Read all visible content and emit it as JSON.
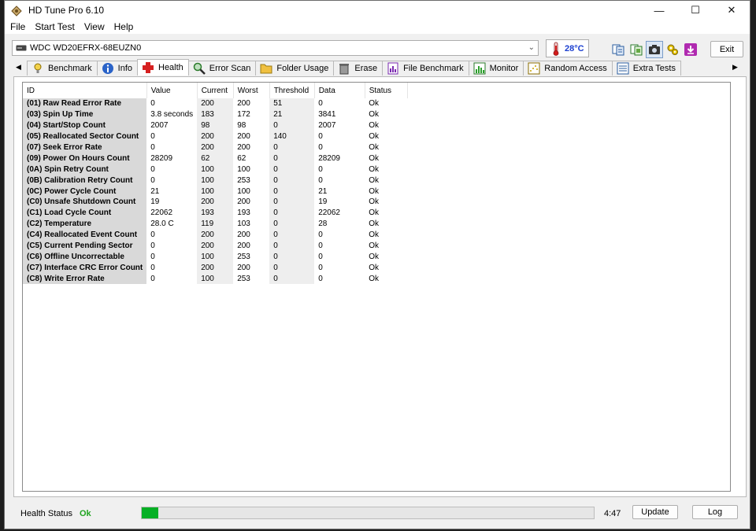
{
  "window": {
    "title": "HD Tune Pro 6.10",
    "controls": [
      "—",
      "☐",
      "✕"
    ]
  },
  "menu": [
    "File",
    "Start Test",
    "View",
    "Help"
  ],
  "toolbar": {
    "drive": "WDC WD20EFRX-68EUZN0",
    "temperature": "28°C",
    "exit_label": "Exit"
  },
  "tabs": [
    {
      "label": "Benchmark",
      "icon": "benchmark-icon"
    },
    {
      "label": "Info",
      "icon": "info-icon"
    },
    {
      "label": "Health",
      "icon": "health-cross-icon",
      "selected": true
    },
    {
      "label": "Error Scan",
      "icon": "magnifier-icon"
    },
    {
      "label": "Folder Usage",
      "icon": "folder-icon"
    },
    {
      "label": "Erase",
      "icon": "trash-icon"
    },
    {
      "label": "File Benchmark",
      "icon": "file-benchmark-icon"
    },
    {
      "label": "Monitor",
      "icon": "monitor-chart-icon"
    },
    {
      "label": "Random Access",
      "icon": "random-access-icon"
    },
    {
      "label": "Extra Tests",
      "icon": "extra-tests-icon"
    }
  ],
  "table": {
    "columns": [
      "ID",
      "Value",
      "Current",
      "Worst",
      "Threshold",
      "Data",
      "Status"
    ],
    "rows": [
      [
        "(01) Raw Read Error Rate",
        "0",
        "200",
        "200",
        "51",
        "0",
        "Ok"
      ],
      [
        "(03) Spin Up Time",
        "3.8 seconds",
        "183",
        "172",
        "21",
        "3841",
        "Ok"
      ],
      [
        "(04) Start/Stop Count",
        "2007",
        "98",
        "98",
        "0",
        "2007",
        "Ok"
      ],
      [
        "(05) Reallocated Sector Count",
        "0",
        "200",
        "200",
        "140",
        "0",
        "Ok"
      ],
      [
        "(07) Seek Error Rate",
        "0",
        "200",
        "200",
        "0",
        "0",
        "Ok"
      ],
      [
        "(09) Power On Hours Count",
        "28209",
        "62",
        "62",
        "0",
        "28209",
        "Ok"
      ],
      [
        "(0A) Spin Retry Count",
        "0",
        "100",
        "100",
        "0",
        "0",
        "Ok"
      ],
      [
        "(0B) Calibration Retry Count",
        "0",
        "100",
        "253",
        "0",
        "0",
        "Ok"
      ],
      [
        "(0C) Power Cycle Count",
        "21",
        "100",
        "100",
        "0",
        "21",
        "Ok"
      ],
      [
        "(C0) Unsafe Shutdown Count",
        "19",
        "200",
        "200",
        "0",
        "19",
        "Ok"
      ],
      [
        "(C1) Load Cycle Count",
        "22062",
        "193",
        "193",
        "0",
        "22062",
        "Ok"
      ],
      [
        "(C2) Temperature",
        "28.0 C",
        "119",
        "103",
        "0",
        "28",
        "Ok"
      ],
      [
        "(C4) Reallocated Event Count",
        "0",
        "200",
        "200",
        "0",
        "0",
        "Ok"
      ],
      [
        "(C5) Current Pending Sector",
        "0",
        "200",
        "200",
        "0",
        "0",
        "Ok"
      ],
      [
        "(C6) Offline Uncorrectable",
        "0",
        "100",
        "253",
        "0",
        "0",
        "Ok"
      ],
      [
        "(C7) Interface CRC Error Count",
        "0",
        "200",
        "200",
        "0",
        "0",
        "Ok"
      ],
      [
        "(C8) Write Error Rate",
        "0",
        "100",
        "253",
        "0",
        "0",
        "Ok"
      ]
    ]
  },
  "status": {
    "health_label": "Health Status",
    "health_value": "Ok",
    "progress_fraction": 0.037,
    "time": "4:47",
    "update_label": "Update",
    "log_label": "Log"
  },
  "colors": {
    "ok_green": "#1fa41f",
    "progress_green": "#06b025",
    "temp_blue": "#1b3fd0"
  }
}
